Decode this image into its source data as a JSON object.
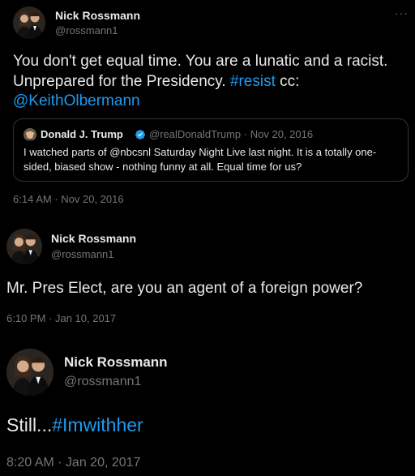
{
  "tweet1": {
    "author_name": "Nick Rossmann",
    "author_handle": "@rossmann1",
    "more_icon": "more-horizontal-icon",
    "text_before": "You don't get equal time. You are a lunatic and a racist. Unprepared for the Presidency. ",
    "hashtag": "#resist",
    "text_middle": " cc: ",
    "mention": "@KeithOlbermann",
    "quote": {
      "author_name": "Donald J. Trump",
      "author_handle": "@realDonaldTrump",
      "dot": "·",
      "date": "Nov 20, 2016",
      "verified_icon": "verified-badge-icon",
      "text": "I watched parts of @nbcsnl Saturday Night Live last night. It is a totally one-sided, biased show - nothing funny at all. Equal time for us?"
    },
    "timestamp": "6:14 AM · Nov 20, 2016"
  },
  "tweet2": {
    "author_name": "Nick Rossmann",
    "author_handle": "@rossmann1",
    "text": "Mr. Pres Elect, are you an agent of a foreign power?",
    "timestamp": "6:10 PM · Jan 10, 2017"
  },
  "tweet3": {
    "author_name": "Nick Rossmann",
    "author_handle": "@rossmann1",
    "text_before": "Still...",
    "hashtag": "#Imwithher",
    "timestamp": "8:20 AM · Jan 20, 2017"
  },
  "colors": {
    "background": "#000000",
    "text": "#e7e9ea",
    "secondary": "#71767b",
    "link": "#1d9bf0",
    "border": "#2f3336"
  }
}
